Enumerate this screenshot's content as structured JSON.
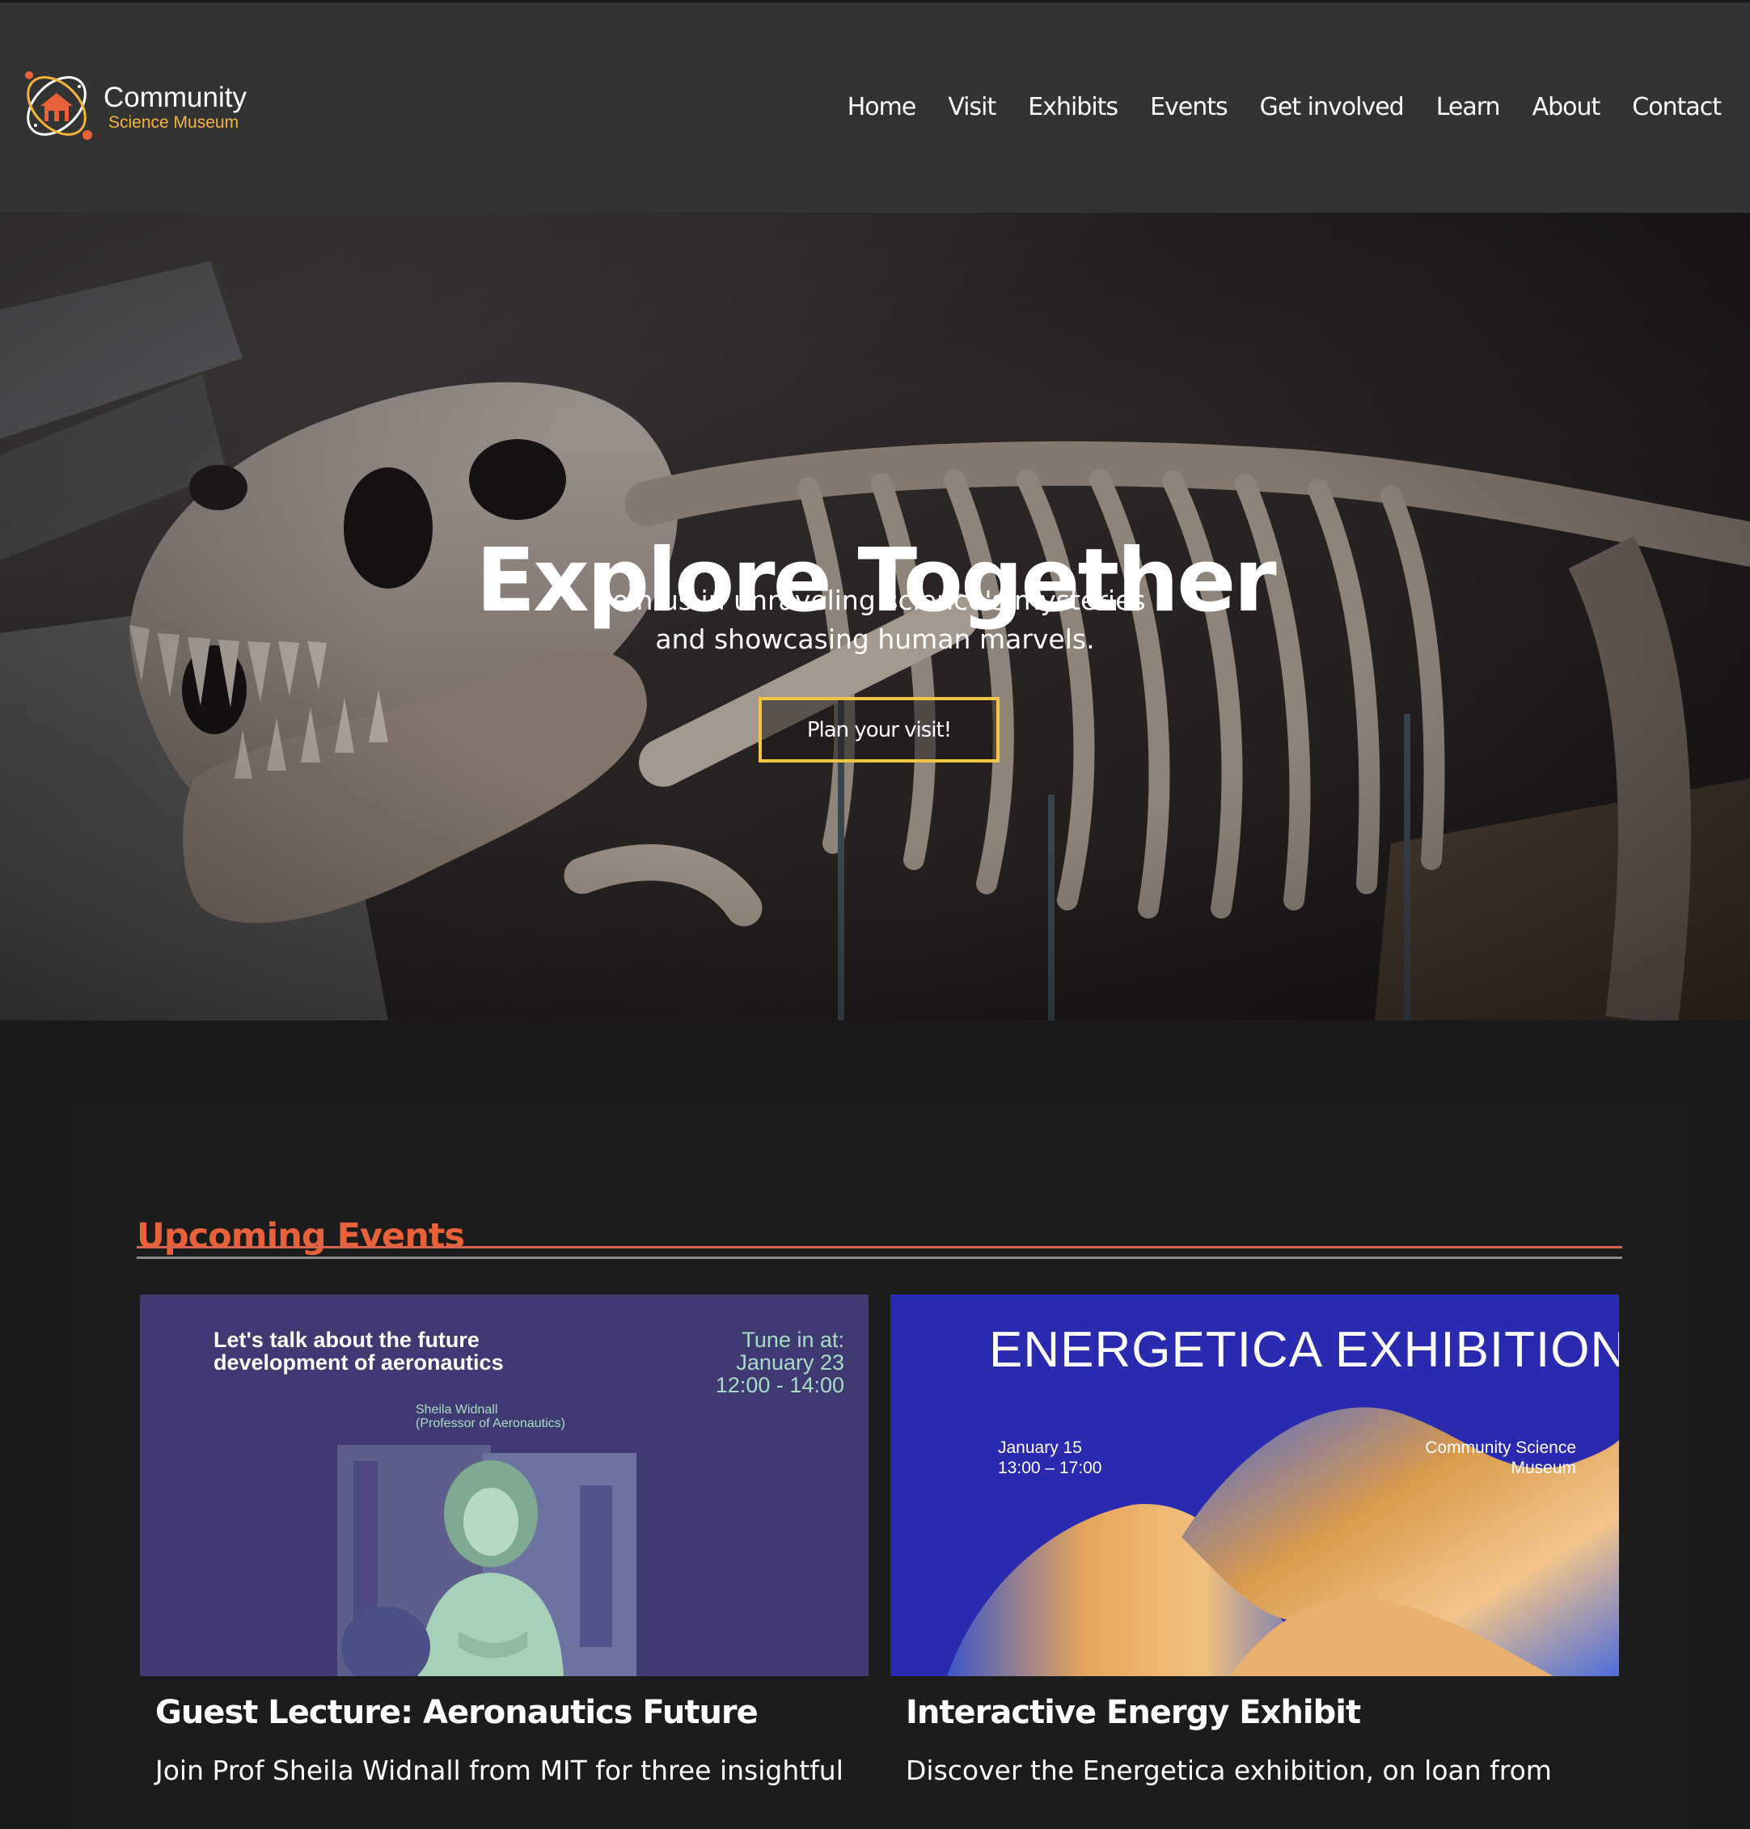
{
  "brand": {
    "name": "Community",
    "subtitle": "Science Museum",
    "accent_color": "#f2b53a",
    "icon": "atom-house-logo"
  },
  "nav": {
    "items": [
      {
        "label": "Home"
      },
      {
        "label": "Visit"
      },
      {
        "label": "Exhibits"
      },
      {
        "label": "Events"
      },
      {
        "label": "Get involved"
      },
      {
        "label": "Learn"
      },
      {
        "label": "About"
      },
      {
        "label": "Contact"
      }
    ]
  },
  "hero": {
    "title": "Explore Together",
    "subtitle_line1": "Join us in unraveling science's mysteries",
    "subtitle_line2": "and showcasing human marvels.",
    "cta_label": "Plan your visit!",
    "cta_border_color": "#f2c644",
    "image": "t-rex-skeleton-photo"
  },
  "events": {
    "heading": "Upcoming Events",
    "heading_color": "#e8613a",
    "cards": [
      {
        "poster": {
          "title": "Let's talk about the future development of aeronautics",
          "tune_in": "Tune in at:",
          "date": "January  23",
          "time": "12:00 - 14:00",
          "speaker_name": "Sheila Widnall",
          "speaker_role": "(Professor of Aeronautics)",
          "image": "speaker-portrait-photo"
        },
        "title": "Guest Lecture: Aeronautics Future",
        "text": "Join Prof Sheila Widnall from MIT for three insightful"
      },
      {
        "poster": {
          "title": "ENERGETICA EXHIBITION",
          "date": "January 15",
          "time": "13:00 – 17:00",
          "place_line1": "Community Science",
          "place_line2": "Museum",
          "image": "wave-ribbon-art"
        },
        "title": "Interactive Energy Exhibit",
        "text": "Discover the Energetica exhibition, on loan from"
      }
    ]
  }
}
